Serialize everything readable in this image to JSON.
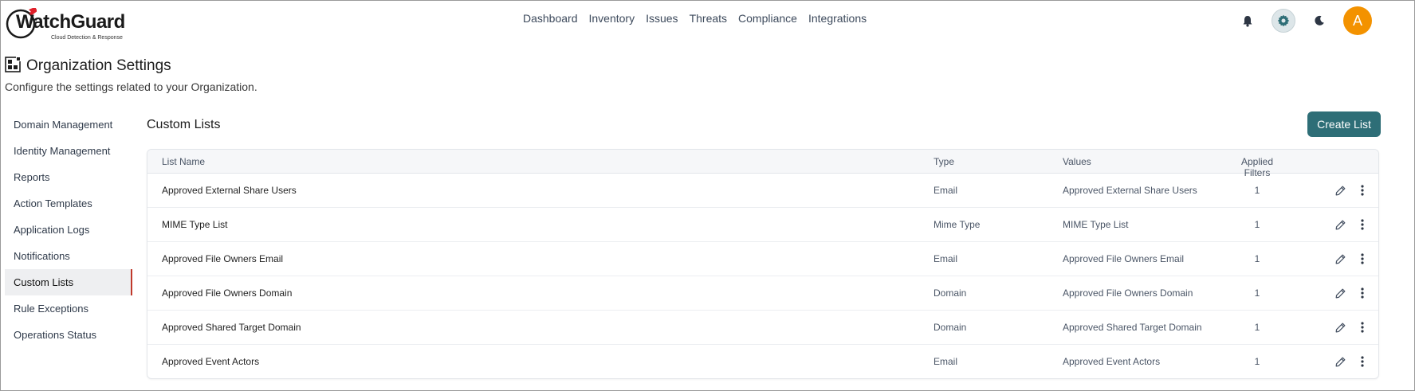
{
  "brand": {
    "name": "WatchGuard",
    "tagline": "Cloud Detection & Response"
  },
  "nav": [
    "Dashboard",
    "Inventory",
    "Issues",
    "Threats",
    "Compliance",
    "Integrations"
  ],
  "header_actions": {
    "avatar_initial": "A",
    "icons": [
      "bell-icon",
      "gear-icon",
      "moon-icon"
    ]
  },
  "page": {
    "title": "Organization Settings",
    "subtitle": "Configure the settings related to your Organization."
  },
  "sidebar": {
    "items": [
      "Domain Management",
      "Identity Management",
      "Reports",
      "Action Templates",
      "Application Logs",
      "Notifications",
      "Custom Lists",
      "Rule Exceptions",
      "Operations Status"
    ],
    "active": "Custom Lists"
  },
  "main": {
    "title": "Custom Lists",
    "create_label": "Create List",
    "columns": [
      "List Name",
      "Type",
      "Values",
      "Applied Filters"
    ],
    "rows": [
      {
        "name": "Approved External Share Users",
        "type": "Email",
        "values": "Approved External Share Users",
        "filters": "1"
      },
      {
        "name": "MIME Type List",
        "type": "Mime Type",
        "values": "MIME Type List",
        "filters": "1"
      },
      {
        "name": "Approved File Owners Email",
        "type": "Email",
        "values": "Approved File Owners Email",
        "filters": "1"
      },
      {
        "name": "Approved File Owners Domain",
        "type": "Domain",
        "values": "Approved File Owners Domain",
        "filters": "1"
      },
      {
        "name": "Approved Shared Target Domain",
        "type": "Domain",
        "values": "Approved Shared Target Domain",
        "filters": "1"
      },
      {
        "name": "Approved Event Actors",
        "type": "Email",
        "values": "Approved Event Actors",
        "filters": "1"
      }
    ]
  },
  "colors": {
    "accent": "#2e6e77",
    "avatar": "#f39200",
    "logo_red": "#e0202a",
    "active_marker": "#c0392b"
  }
}
